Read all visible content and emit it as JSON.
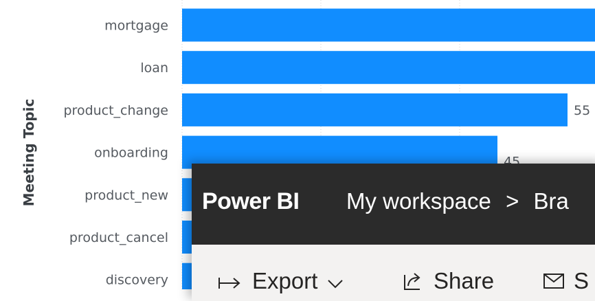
{
  "chart_data": {
    "type": "bar",
    "orientation": "horizontal",
    "ylabel": "Meeting Topic",
    "categories": [
      "mortgage",
      "loan",
      "product_change",
      "onboarding",
      "product_new",
      "product_cancel",
      "discovery"
    ],
    "values": [
      null,
      null,
      55,
      45,
      null,
      null,
      null
    ],
    "value_labels": [
      "",
      "",
      "55",
      "45",
      "",
      "",
      ""
    ],
    "bar_color": "#118dff",
    "grid": true
  },
  "powerbi": {
    "brand": "Power BI",
    "breadcrumb": [
      "My workspace",
      ">",
      "Bra"
    ],
    "toolbar": {
      "export_label": "Export",
      "share_label": "Share",
      "email_label": "S"
    },
    "header_color": "#2b2b2b",
    "toolbar_color": "#f3f2f1"
  }
}
